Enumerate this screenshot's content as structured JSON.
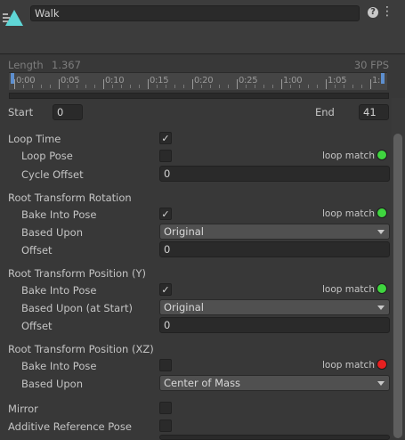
{
  "header": {
    "clip_name": "Walk",
    "help_icon": "?",
    "menu_icon": "⋮"
  },
  "timeline": {
    "length_label": "Length",
    "length_value": "1.367",
    "fps_label": "30 FPS",
    "ticks": [
      "0:00",
      "0:05",
      "0:10",
      "0:15",
      "0:20",
      "0:25",
      "1:00",
      "1:05",
      "1:"
    ]
  },
  "range": {
    "start_label": "Start",
    "start_value": "0",
    "end_label": "End",
    "end_value": "41"
  },
  "loop": {
    "loop_time_label": "Loop Time",
    "loop_pose_label": "Loop Pose",
    "loop_match": "loop match",
    "cycle_offset_label": "Cycle Offset",
    "cycle_offset_value": "0"
  },
  "rotation": {
    "section_label": "Root Transform Rotation",
    "bake_label": "Bake Into Pose",
    "loop_match": "loop match",
    "based_label": "Based Upon",
    "based_value": "Original",
    "offset_label": "Offset",
    "offset_value": "0"
  },
  "position_y": {
    "section_label": "Root Transform Position (Y)",
    "bake_label": "Bake Into Pose",
    "loop_match": "loop match",
    "based_label": "Based Upon (at Start)",
    "based_value": "Original",
    "offset_label": "Offset",
    "offset_value": "0"
  },
  "position_xz": {
    "section_label": "Root Transform Position (XZ)",
    "bake_label": "Bake Into Pose",
    "loop_match": "loop match",
    "based_label": "Based Upon",
    "based_value": "Center of Mass"
  },
  "misc": {
    "mirror_label": "Mirror",
    "additive_label": "Additive Reference Pose"
  },
  "colors": {
    "match_ok": "#3fd53f",
    "match_bad": "#e62020",
    "accent": "#5d8fcf"
  }
}
